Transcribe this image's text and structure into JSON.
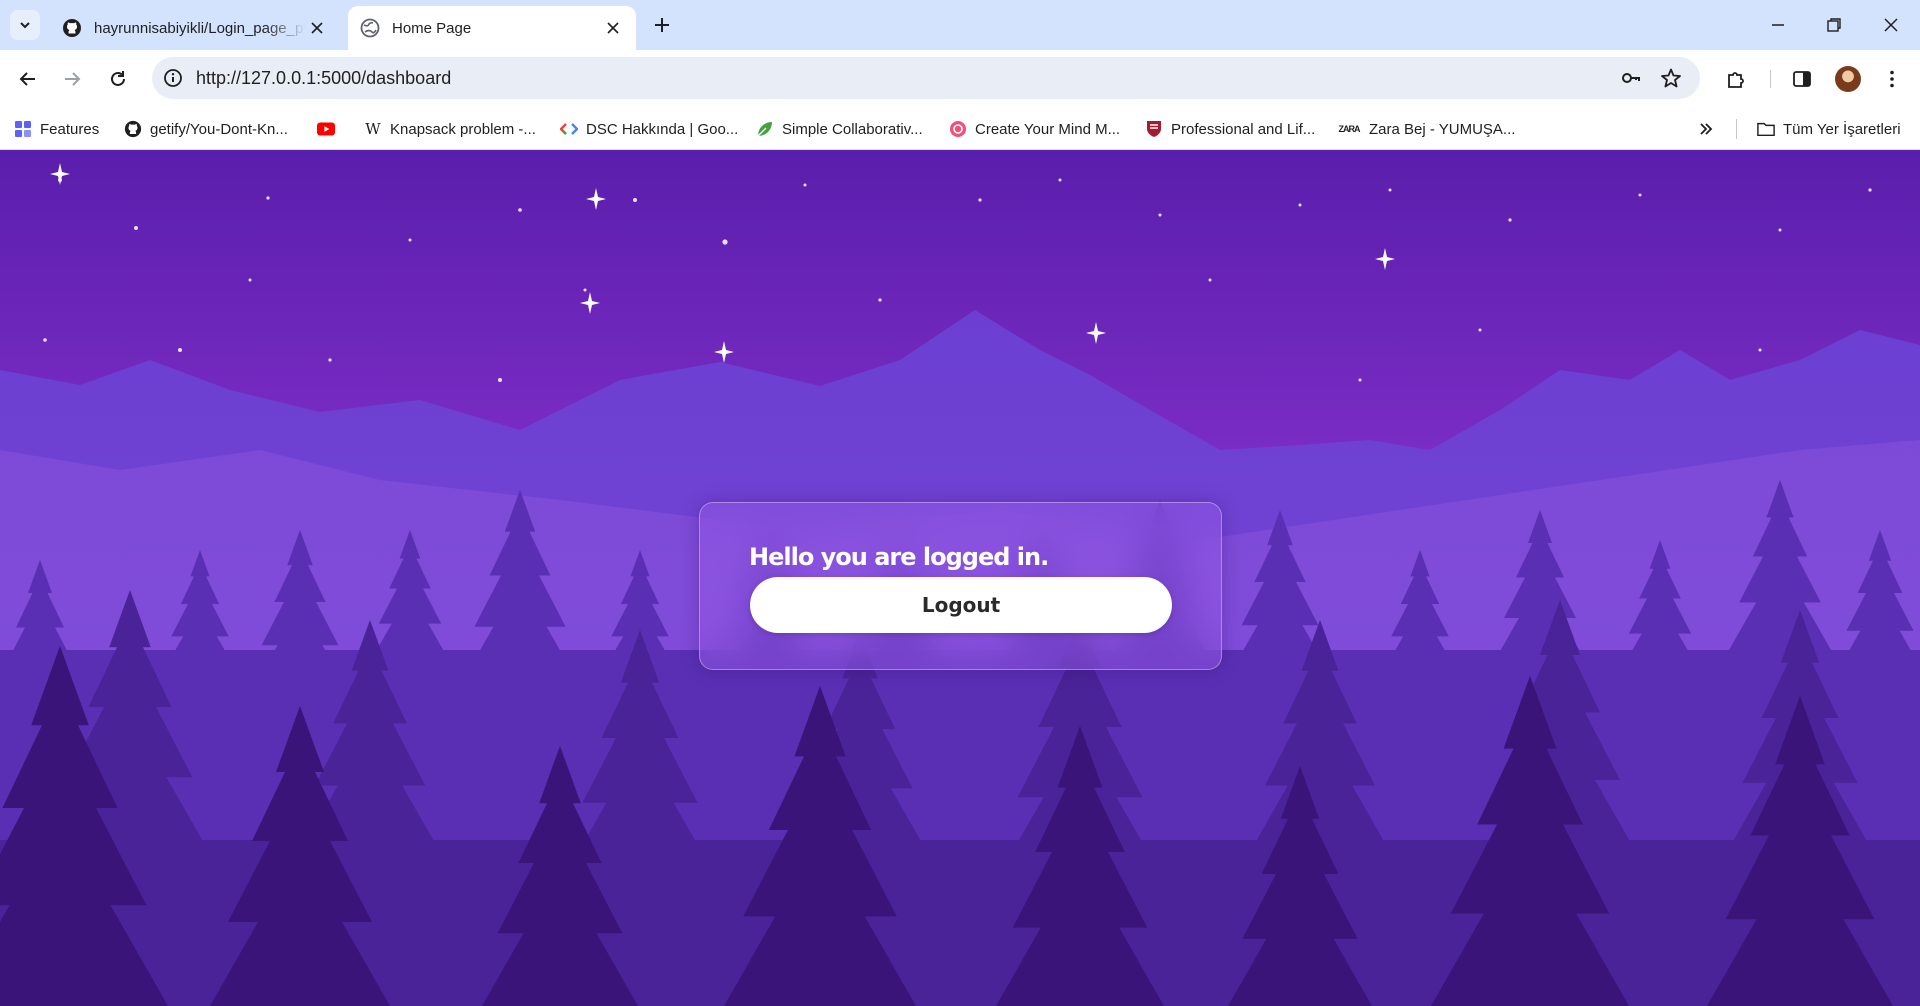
{
  "browser": {
    "tabs": [
      {
        "title": "hayrunnisabiyikli/Login_page_python",
        "favicon": "github-icon",
        "active": false
      },
      {
        "title": "Home Page",
        "favicon": "globe-icon",
        "active": true
      }
    ],
    "url": "http://127.0.0.1:5000/dashboard",
    "bookmarks": [
      {
        "label": "Features",
        "icon": "grid-icon"
      },
      {
        "label": "getify/You-Dont-Kn...",
        "icon": "github-icon"
      },
      {
        "label": "",
        "icon": "youtube-icon"
      },
      {
        "label": "Knapsack problem -...",
        "icon": "wikipedia-icon"
      },
      {
        "label": "DSC Hakkında | Goo...",
        "icon": "gdsc-icon"
      },
      {
        "label": "Simple Collaborativ...",
        "icon": "overleaf-icon"
      },
      {
        "label": "Create Your Mind M...",
        "icon": "mindmap-icon"
      },
      {
        "label": "Professional and Lif...",
        "icon": "shield-icon"
      },
      {
        "label": "Zara Bej - YUMUŞA...",
        "icon": "zara-icon"
      }
    ],
    "all_bookmarks_label": "Tüm Yer İşaretleri"
  },
  "page": {
    "heading": "Hello you are logged in.",
    "logout_label": "Logout"
  },
  "colors": {
    "sky_top": "#5b1fb0",
    "sky_glow": "#c257e6",
    "mountains": "#6a3cd0",
    "trees_back": "#5a2fb4",
    "trees_front": "#3a1478",
    "button_bg": "#ffffff",
    "tabstrip_bg": "#d3e3fd"
  }
}
